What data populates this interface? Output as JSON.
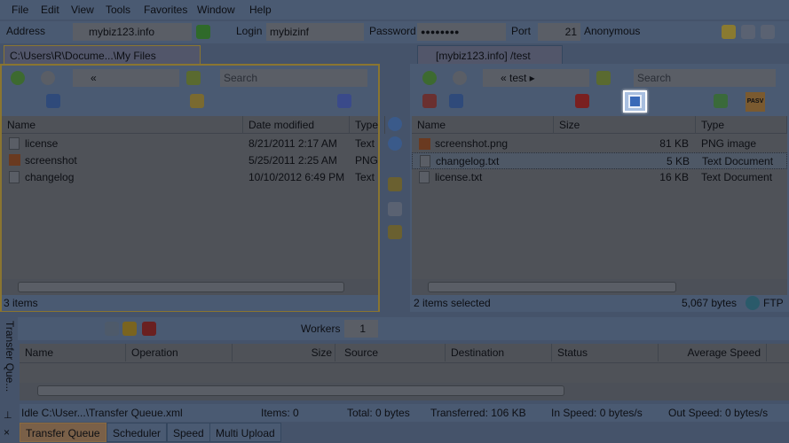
{
  "menu": [
    "File",
    "Edit",
    "View",
    "Tools",
    "Favorites",
    "Window",
    "Help"
  ],
  "address": {
    "label": "Address",
    "value": "mybiz123.info",
    "login_label": "Login",
    "login": "mybizinf",
    "password_label": "Password",
    "password": "●●●●●●●●",
    "port_label": "Port",
    "port": "21",
    "anonymous": "Anonymous"
  },
  "left": {
    "tab": "C:\\Users\\R\\Docume...\\My Files",
    "path": "«",
    "search_placeholder": "Search",
    "columns": [
      "Name",
      "Date modified",
      "Type"
    ],
    "files": [
      {
        "name": "license",
        "date": "8/21/2011 2:17 AM",
        "type": "Text"
      },
      {
        "name": "screenshot",
        "date": "5/25/2011 2:25 AM",
        "type": "PNG"
      },
      {
        "name": "changelog",
        "date": "10/10/2012 6:49 PM",
        "type": "Text"
      }
    ],
    "status": "3 items"
  },
  "right": {
    "tab": "[mybiz123.info] /test",
    "path": "« test ▸",
    "search_placeholder": "Search",
    "columns": [
      "Name",
      "Size",
      "Type"
    ],
    "files": [
      {
        "name": "screenshot.png",
        "size": "81 KB",
        "type": "PNG image"
      },
      {
        "name": "changelog.txt",
        "size": "5 KB",
        "type": "Text Document"
      },
      {
        "name": "license.txt",
        "size": "16 KB",
        "type": "Text Document"
      }
    ],
    "status": "2 items selected",
    "bytes": "5,067  bytes",
    "protocol": "FTP",
    "pasv": "PASV"
  },
  "queue": {
    "side_label": "Transfer Que...",
    "workers_label": "Workers",
    "workers": "1",
    "columns": [
      "Name",
      "Operation",
      "Size",
      "Source",
      "Destination",
      "Status",
      "Average Speed"
    ],
    "status": [
      "Idle   C:\\User...\\Transfer Queue.xml",
      "Items: 0",
      "Total: 0 bytes",
      "Transferred: 106 KB",
      "In Speed: 0 bytes/s",
      "Out Speed: 0 bytes/s"
    ],
    "tabs": [
      "Transfer Queue",
      "Scheduler",
      "Speed",
      "Multi Upload"
    ]
  },
  "colors": {
    "highlight": "#ffffff",
    "active_tab": "#a07a4a",
    "left_border": "#b0953a"
  }
}
